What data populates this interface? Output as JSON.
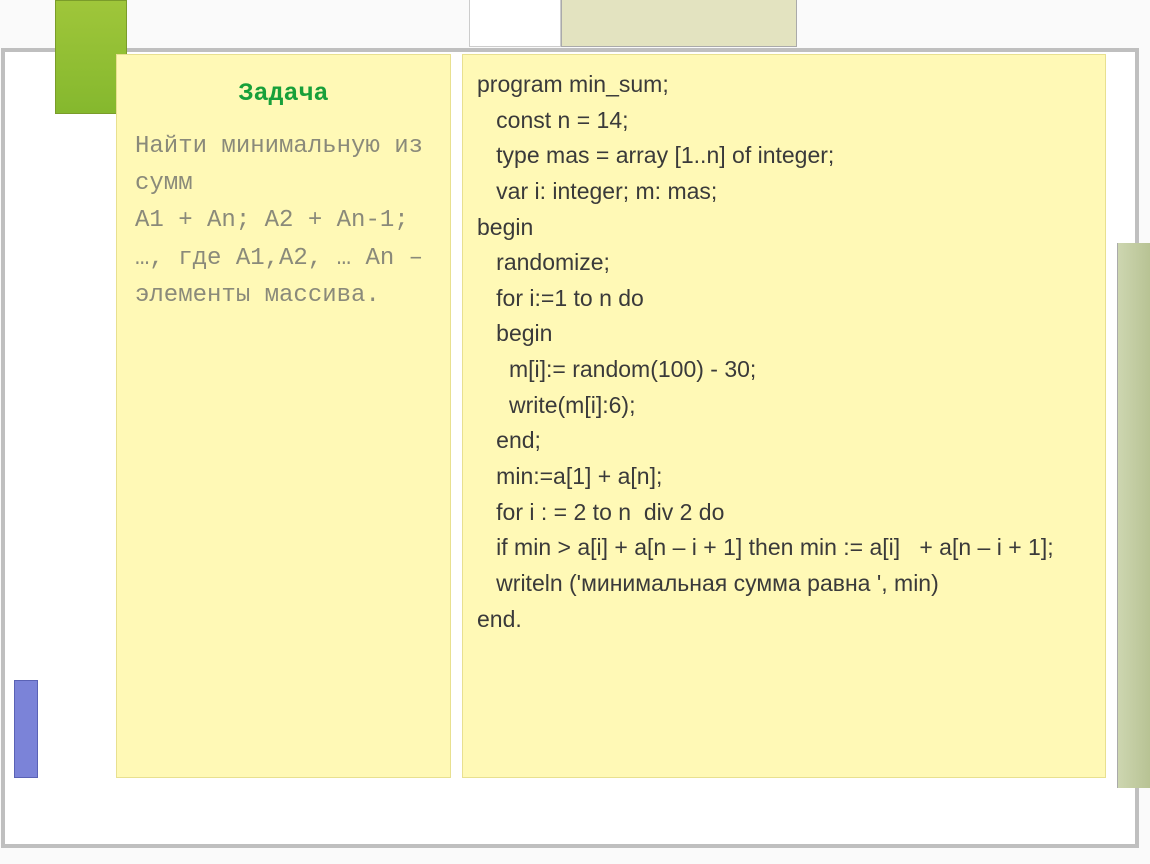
{
  "left": {
    "title": "Задача",
    "body_lines": [
      "Найти минимальную из сумм",
      "A1 + An; A2 + An-1;",
      "…, где A1,A2, … An – элементы массива."
    ]
  },
  "code": {
    "lines": [
      "program min_sum;",
      "   const n = 14;",
      "   type mas = array [1..n] of integer;",
      "   var i: integer; m: mas;",
      "begin",
      "   randomize;",
      "   for i:=1 to n do",
      "   begin",
      "     m[i]:= random(100) - 30;",
      "     write(m[i]:6);",
      "   end;",
      "   min:=a[1] + a[n];",
      "   for i : = 2 to n  div 2 do",
      "   if min > a[i] + a[n – i + 1] then min := a[i]   + a[n – i + 1];",
      "   writeln ('минимальная сумма равна ', min)",
      "end."
    ]
  }
}
